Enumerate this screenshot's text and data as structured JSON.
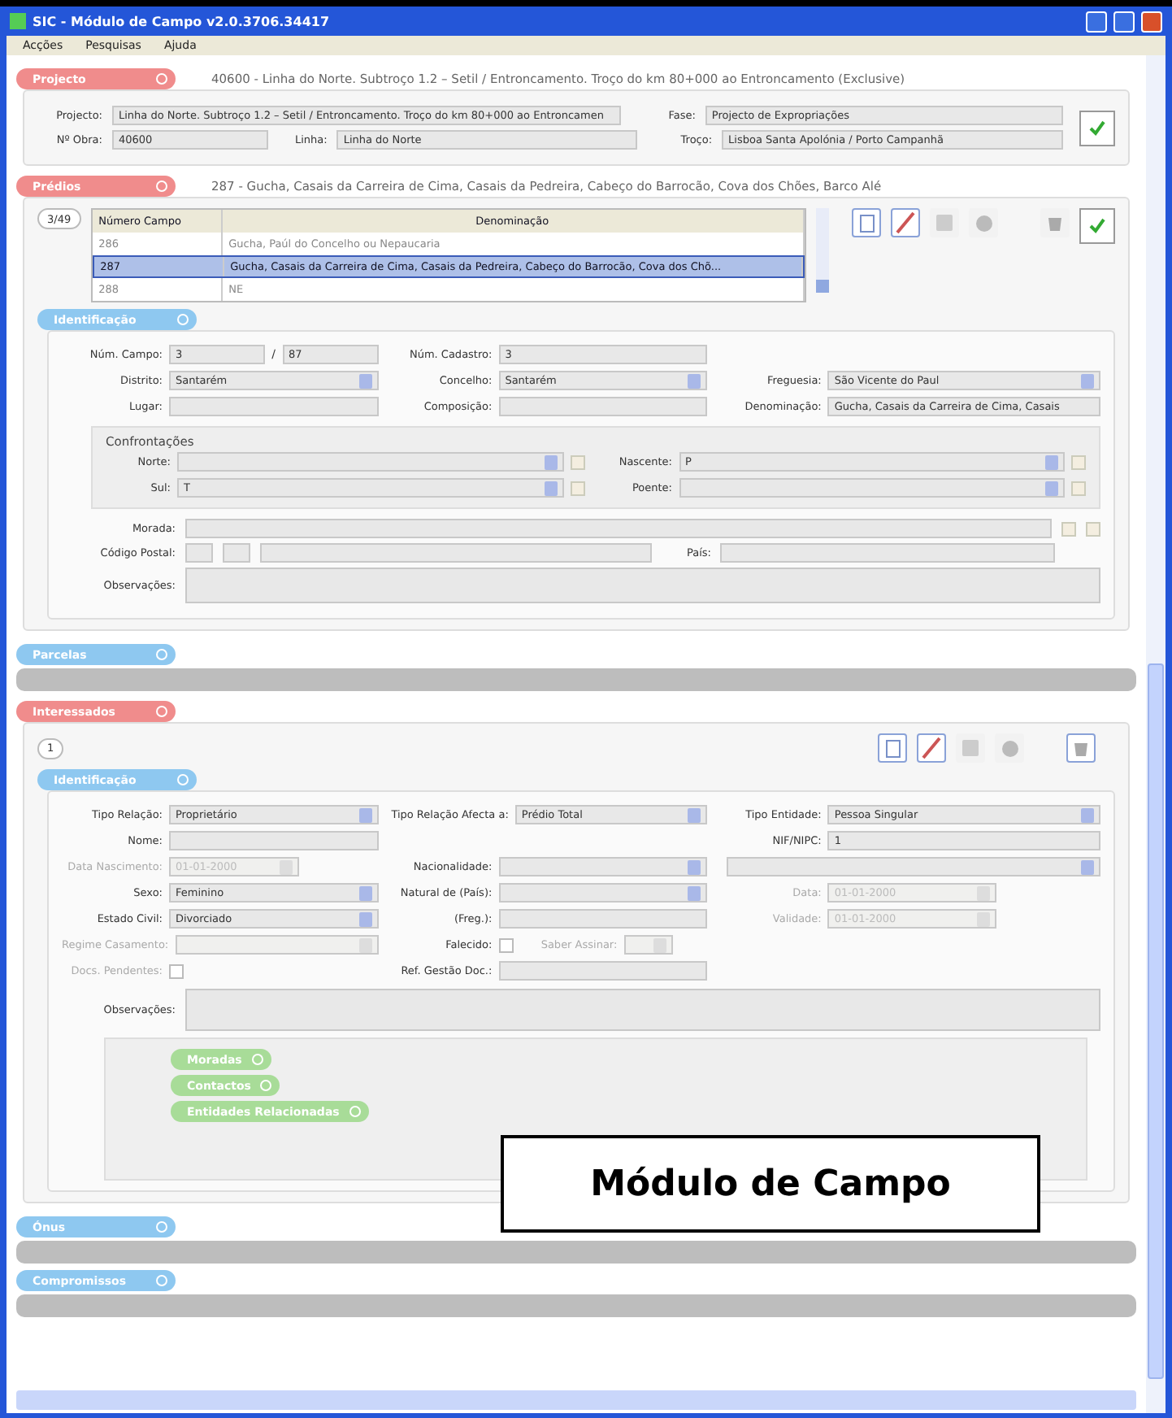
{
  "window": {
    "title": "SIC - Módulo de Campo v2.0.3706.34417"
  },
  "menu": [
    "Acções",
    "Pesquisas",
    "Ajuda"
  ],
  "projecto": {
    "tag": {
      "label": "Projecto",
      "color": "#f08c8c"
    },
    "heading": "40600 - Linha do Norte. Subtroço 1.2 – Setil / Entroncamento. Troço do km 80+000 ao Entroncamento (Exclusive)",
    "fields": [
      {
        "label": "Projecto:",
        "value": "Linha do Norte. Subtroço 1.2 – Setil / Entroncamento. Troço do km 80+000 ao Entroncamen"
      },
      {
        "label": "Fase:",
        "value": "Projecto de Expropriações"
      },
      {
        "label": "Nº Obra:",
        "value": "40600"
      },
      {
        "label": "Linha:",
        "value": "Linha do Norte"
      },
      {
        "label": "Troço:",
        "value": "Lisboa Santa Apolónia / Porto Campanhã"
      }
    ]
  },
  "predio": {
    "tag": {
      "label": "Prédios",
      "color": "#f08c8c"
    },
    "heading": "287 - Gucha, Casais da Carreira de Cima, Casais da Pedreira, Cabeço do Barrocão, Cova dos Chões, Barco Alé",
    "counter": "3/49",
    "table": {
      "columns": [
        "Número Campo",
        "Denominação"
      ],
      "rows": [
        {
          "cells": [
            "286",
            "Gucha, Paúl do Concelho ou Nepaucaria"
          ],
          "selected": false
        },
        {
          "cells": [
            "287",
            "Gucha, Casais da Carreira de Cima, Casais da Pedreira, Cabeço do Barrocão, Cova dos Chõ..."
          ],
          "selected": true
        },
        {
          "cells": [
            "288",
            "NE"
          ],
          "selected": false
        }
      ]
    },
    "identificacao": {
      "tag": {
        "label": "Identificação",
        "color": "#8ec8f0"
      },
      "rows": [
        [
          {
            "kind": "pair",
            "label": "Núm. Campo:",
            "value": "3",
            "separator": "/",
            "value2": "87"
          },
          {
            "kind": "text",
            "label": "Núm. Cadastro:",
            "value": "3"
          }
        ],
        [
          {
            "kind": "select",
            "label": "Distrito:",
            "value": "Santarém"
          },
          {
            "kind": "select",
            "label": "Concelho:",
            "value": "Santarém"
          },
          {
            "kind": "select",
            "label": "Freguesia:",
            "value": "São Vicente do Paul"
          }
        ],
        [
          {
            "kind": "text",
            "label": "Lugar:"
          },
          {
            "kind": "text",
            "label": "Composição:"
          },
          {
            "kind": "text",
            "label": "Denominação:",
            "value": "Gucha, Casais da Carreira de Cima, Casais"
          }
        ]
      ]
    },
    "confrontacoes": {
      "title": "Confrontações",
      "items": [
        {
          "label": "Norte:"
        },
        {
          "label": "Nascente:",
          "value": "P"
        },
        {
          "label": "Sul:",
          "value": "T"
        },
        {
          "label": "Poente:"
        }
      ]
    },
    "morada": {
      "label": "Morada:",
      "postal_label": "Código Postal:",
      "country_label": "País:",
      "notes_label": "Observações:"
    }
  },
  "parcelas": {
    "tag": {
      "label": "Parcelas",
      "color": "#8ec8f0"
    }
  },
  "interessados": {
    "tag": {
      "label": "Interessados",
      "color": "#f08c8c"
    },
    "counter": "1",
    "identificacao": {
      "tag": {
        "label": "Identificação",
        "color": "#8ec8f0"
      },
      "rows": [
        [
          {
            "kind": "select",
            "label": "Tipo Relação:",
            "value": "Proprietário",
            "disabled": false
          },
          {
            "kind": "select",
            "label": "Tipo Relação Afecta a:",
            "value": "Prédio Total",
            "disabled": false
          },
          {
            "kind": "select",
            "label": "Tipo Entidade:",
            "value": "Pessoa Singular",
            "disabled": false
          }
        ],
        [
          {
            "kind": "text",
            "label": "Nome:",
            "disabled": false
          },
          {
            "kind": "blank"
          },
          {
            "kind": "text",
            "label": "NIF/NIPC:",
            "value": "1",
            "disabled": false
          }
        ],
        [
          {
            "kind": "date",
            "label": "Data Nascimento:",
            "value": "01-01-2000",
            "disabled": true
          },
          {
            "kind": "select",
            "label": "Nacionalidade:",
            "disabled": false
          },
          {
            "kind": "select",
            "disabled": false
          }
        ],
        [
          {
            "kind": "select",
            "label": "Sexo:",
            "value": "Feminino",
            "disabled": false
          },
          {
            "kind": "select",
            "label": "Natural de (País):",
            "disabled": false
          },
          {
            "kind": "date",
            "label": "Data:",
            "value": "01-01-2000",
            "disabled": true
          }
        ],
        [
          {
            "kind": "select",
            "label": "Estado Civil:",
            "value": "Divorciado",
            "disabled": false
          },
          {
            "kind": "text",
            "label": "(Freg.):",
            "disabled": false
          },
          {
            "kind": "date",
            "label": "Validade:",
            "value": "01-01-2000",
            "disabled": true
          }
        ],
        [
          {
            "kind": "select",
            "label": "Regime Casamento:",
            "disabled": true
          },
          {
            "kind": "check",
            "label": "Falecido:",
            "checked": false,
            "disabled": false,
            "extra": {
              "label": "Saber Assinar:",
              "disabled": true
            }
          },
          {
            "kind": "blank"
          }
        ],
        [
          {
            "kind": "check",
            "label": "Docs. Pendentes:",
            "checked": false,
            "disabled": true
          },
          {
            "kind": "text",
            "label": "Ref. Gestão Doc.:",
            "disabled": false
          },
          {
            "kind": "blank"
          }
        ]
      ],
      "notes_label": "Observações:"
    },
    "subsections": [
      {
        "label": "Moradas",
        "color": "#a8dc98"
      },
      {
        "label": "Contactos",
        "color": "#a8dc98"
      },
      {
        "label": "Entidades Relacionadas",
        "color": "#a8dc98"
      }
    ]
  },
  "onus": {
    "tag": {
      "label": "Ónus",
      "color": "#8ec8f0"
    }
  },
  "compromissos": {
    "tag": {
      "label": "Compromissos",
      "color": "#8ec8f0"
    }
  },
  "caption": "Módulo de Campo"
}
